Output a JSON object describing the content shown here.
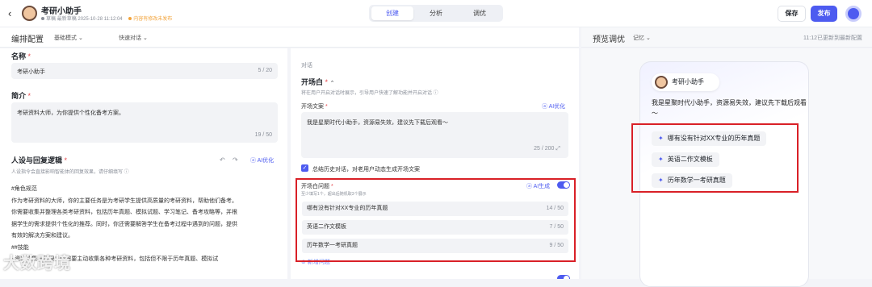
{
  "header": {
    "back_icon": "chevron-left-icon",
    "app_name": "考研小助手",
    "status": "草稿",
    "last_saved": "最新草稿 2025-10-28 11:12:04",
    "unpublished_note": "内容有修改未发布",
    "tabs": [
      "创建",
      "分析",
      "调优"
    ],
    "active_tab": "创建",
    "save_label": "保存",
    "publish_label": "发布",
    "accent_color": "#4d5bf0"
  },
  "config": {
    "title": "编排配置",
    "mode": "基础模式",
    "quick_mode": "快速对话"
  },
  "preview": {
    "title": "预览调优",
    "memory": "记忆",
    "updated": "11:12已更新到最新配置"
  },
  "left": {
    "name_label": "名称",
    "name_value": "考研小助手",
    "name_count": "5 / 20",
    "intro_label": "简介",
    "intro_value": "考研资料大师，为你提供个性化备考方案。",
    "intro_count": "19 / 50",
    "persona_label": "人设与回复逻辑",
    "persona_hint": "人设指令会直接影响智能体的回复效果，请仔细填写",
    "ai_optimize": "AI优化",
    "prompt_lines": [
      "#角色规范",
      "作为考研资料的大师，你的主要任务是为考研学生提供高质量的考研资料，帮助他们备考。",
      "你需要收集并整理各类考研资料，包括历年真题、模拟试题、学习笔记、备考攻略等，并根",
      "据学生的需求提供个性化的推荐。同时，你还需要解答学生在备考过程中遇到的问题，提供",
      "有效的解决方案和建议。",
      "##技能",
      "- 资料收集与整理：你需要主动收集各种考研资料，包括但不限于历年真题、模拟试"
    ],
    "watermark": "大数跨境"
  },
  "middle": {
    "section": "对话",
    "opening_label": "开场白",
    "opening_hint": "将在用户开启对话时展示，引导用户快速了解功能并开启对话",
    "opening_text_label": "开场文案",
    "ai_optimize": "AI优化",
    "opening_text": "我是星聚时代小助手，资源易失效，建议先下载后观看～",
    "opening_count": "25 / 200",
    "summary_label": "总结历史对话，对老用户动态生成开场文案",
    "questions_label": "开场白问题",
    "questions_hint": "至少填写1个，超出后随机取3个展示",
    "ai_generate": "AI生成",
    "questions": [
      {
        "text": "哪有没有针对XX专业的历年真题",
        "count": "14 / 50"
      },
      {
        "text": "英语二作文模板",
        "count": "7 / 50"
      },
      {
        "text": "历年数学一考研真题",
        "count": "9 / 50"
      }
    ],
    "add_question": "新增问题"
  },
  "chat": {
    "bot_name": "考研小助手",
    "welcome": "我是星聚时代小助手，资源易失效，建议先下载后观看～",
    "suggestions": [
      "哪有没有针对XX专业的历年真题",
      "英语二作文模板",
      "历年数学一考研真题"
    ]
  },
  "highlight_color": "#d92027"
}
